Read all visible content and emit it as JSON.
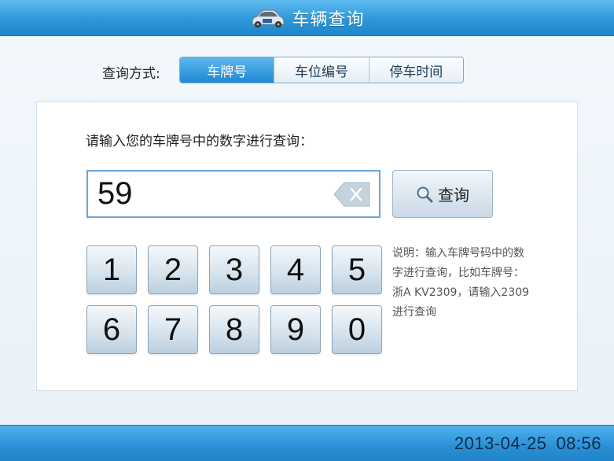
{
  "header": {
    "title": "车辆查询",
    "icon": "car-icon"
  },
  "mode": {
    "label": "查询方式:",
    "options": [
      "车牌号",
      "车位编号",
      "停车时间"
    ],
    "selected": "车牌号"
  },
  "search": {
    "prompt": "请输入您的车牌号中的数字进行查询：",
    "value": "59",
    "button_label": "查询"
  },
  "keypad": {
    "keys": [
      "1",
      "2",
      "3",
      "4",
      "5",
      "6",
      "7",
      "8",
      "9",
      "0"
    ]
  },
  "note": "说明：输入车牌号码中的数字进行查询，比如车牌号：浙A KV2309，请输入2309进行查询",
  "footer": {
    "date": "2013-04-25",
    "time": "08:56"
  },
  "colors": {
    "accent": "#1f88d2",
    "header": "#2e97d8"
  }
}
